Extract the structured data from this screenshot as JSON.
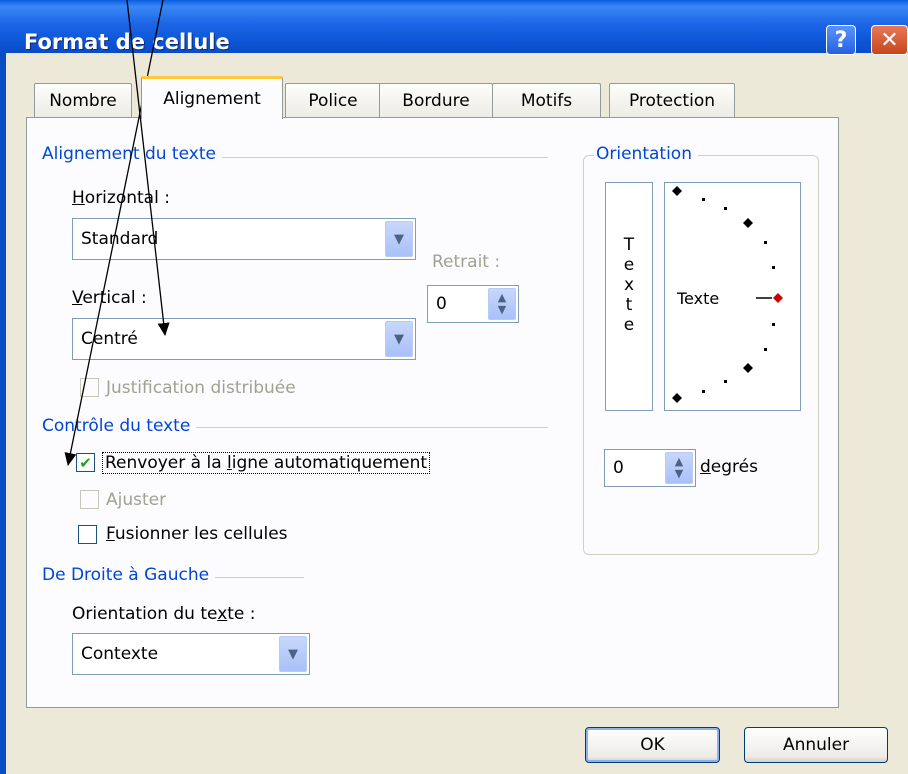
{
  "window": {
    "title": "Format de cellule"
  },
  "titlebar": {
    "help_glyph": "?",
    "close_glyph": "✕"
  },
  "tabs": [
    {
      "label": "Nombre",
      "active": false
    },
    {
      "label": "Alignement",
      "active": true
    },
    {
      "label": "Police",
      "active": false
    },
    {
      "label": "Bordure",
      "active": false
    },
    {
      "label": "Motifs",
      "active": false
    },
    {
      "label": "Protection",
      "active": false
    }
  ],
  "alignment": {
    "group_label": "Alignement du texte",
    "horizontal_label_u": "H",
    "horizontal_label_rest": "orizontal :",
    "horizontal_value": "Standard",
    "vertical_label_u": "V",
    "vertical_label_rest": "ertical :",
    "vertical_value": "Centré",
    "indent_label": "Retrait :",
    "indent_value": "0",
    "distributed_label": "Justification distribuée",
    "distributed_checked": false
  },
  "text_control": {
    "group_label": "Contrôle du texte",
    "wrap_pre": "Renvoyer à la ",
    "wrap_u": "l",
    "wrap_post": "igne automatiquement",
    "wrap_checked": true,
    "check_glyph": "✔",
    "shrink_label": "Ajuster",
    "merge_u": "F",
    "merge_rest": "usionner les cellules",
    "merge_checked": false
  },
  "rtl": {
    "group_label": "De Droite à Gauche",
    "direction_label_pre": "Orientation du te",
    "direction_label_u": "x",
    "direction_label_post": "te :",
    "direction_value": "Contexte"
  },
  "orientation": {
    "group_label": "Orientation",
    "vertical_letters": [
      "T",
      "e",
      "x",
      "t",
      "e"
    ],
    "dial_text": "Texte",
    "degrees_value": "0",
    "degrees_label_u": "d",
    "degrees_label_rest": "egrés"
  },
  "buttons": {
    "ok": "OK",
    "cancel": "Annuler"
  },
  "colors": {
    "titlebar": "#0a4cc4",
    "group_label": "#0046d5",
    "active_tab_accent": "#ffc83c",
    "dial_marker": "#cc0000"
  },
  "icons": {
    "dropdown": "chevron-down-icon",
    "spinner": "spin-up-down-icon",
    "check": "checkmark-icon"
  }
}
